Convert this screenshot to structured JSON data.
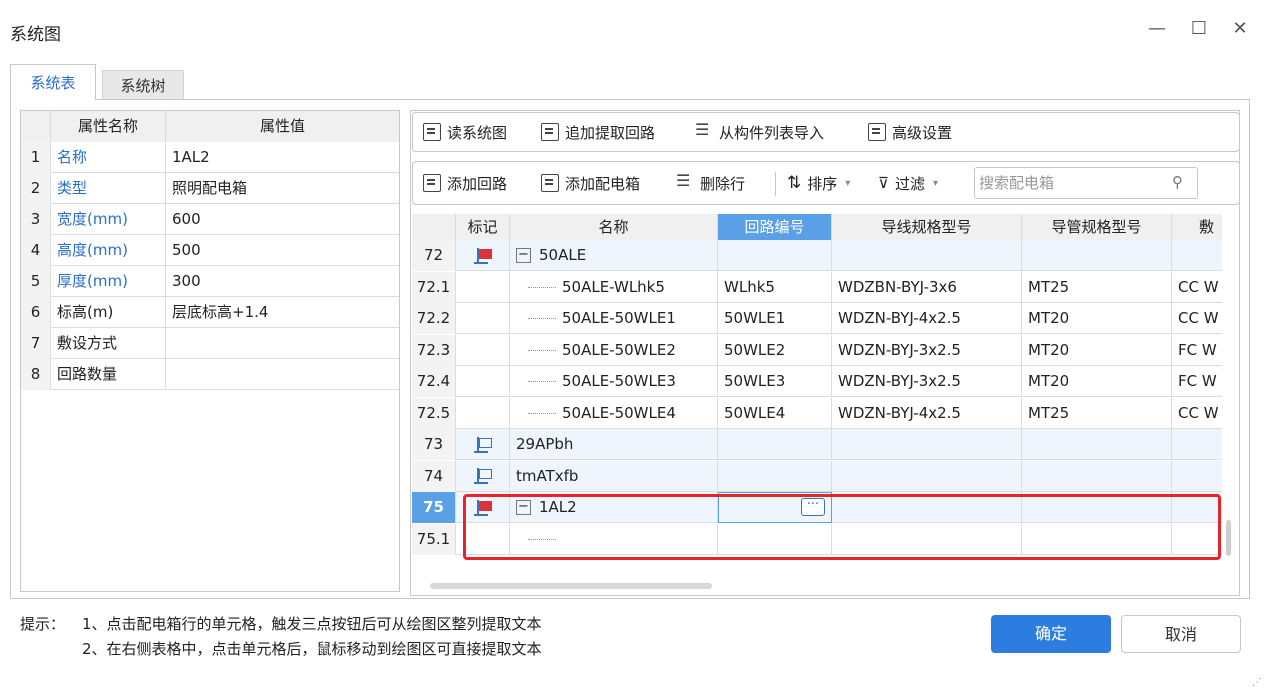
{
  "window": {
    "title": "系统图",
    "minimize": "—",
    "maximize": "☐",
    "close": "✕"
  },
  "tabs": [
    {
      "label": "系统表",
      "active": true
    },
    {
      "label": "系统树",
      "active": false
    }
  ],
  "properties": {
    "headers": [
      "属性名称",
      "属性值"
    ],
    "rows": [
      {
        "num": "1",
        "name": "名称",
        "value": "1AL2"
      },
      {
        "num": "2",
        "name": "类型",
        "value": "照明配电箱"
      },
      {
        "num": "3",
        "name": "宽度(mm)",
        "value": "600"
      },
      {
        "num": "4",
        "name": "高度(mm)",
        "value": "500"
      },
      {
        "num": "5",
        "name": "厚度(mm)",
        "value": "300"
      },
      {
        "num": "6",
        "name": "标高(m)",
        "value": "层底标高+1.4"
      },
      {
        "num": "7",
        "name": "敷设方式",
        "value": ""
      },
      {
        "num": "8",
        "name": "回路数量",
        "value": ""
      }
    ]
  },
  "toolbar1": {
    "read": "读系统图",
    "append": "追加提取回路",
    "import": "从构件列表导入",
    "advanced": "高级设置"
  },
  "toolbar2": {
    "add_circuit": "添加回路",
    "add_box": "添加配电箱",
    "delete_row": "删除行",
    "sort": "排序",
    "filter": "过滤",
    "search_placeholder": "搜索配电箱"
  },
  "grid": {
    "headers": [
      "",
      "标记",
      "名称",
      "回路编号",
      "导线规格型号",
      "导管规格型号",
      "敷"
    ],
    "rows": [
      {
        "num": "72",
        "type": "box",
        "flag": "red",
        "name": "50ALE",
        "code": "",
        "wire": "",
        "pipe": "",
        "lay": ""
      },
      {
        "num": "72.1",
        "type": "child",
        "name": "50ALE-WLhk5",
        "code": "WLhk5",
        "wire": "WDZBN-BYJ-3x6",
        "pipe": "MT25",
        "lay": "CC W"
      },
      {
        "num": "72.2",
        "type": "child",
        "name": "50ALE-50WLE1",
        "code": "50WLE1",
        "wire": "WDZN-BYJ-4x2.5",
        "pipe": "MT20",
        "lay": "CC W"
      },
      {
        "num": "72.3",
        "type": "child",
        "name": "50ALE-50WLE2",
        "code": "50WLE2",
        "wire": "WDZN-BYJ-3x2.5",
        "pipe": "MT20",
        "lay": "FC W"
      },
      {
        "num": "72.4",
        "type": "child",
        "name": "50ALE-50WLE3",
        "code": "50WLE3",
        "wire": "WDZN-BYJ-3x2.5",
        "pipe": "MT20",
        "lay": "FC W"
      },
      {
        "num": "72.5",
        "type": "child",
        "name": "50ALE-50WLE4",
        "code": "50WLE4",
        "wire": "WDZN-BYJ-4x2.5",
        "pipe": "MT25",
        "lay": "CC W"
      },
      {
        "num": "73",
        "type": "box",
        "flag": "blue",
        "name": "29APbh",
        "code": "",
        "wire": "",
        "pipe": "",
        "lay": ""
      },
      {
        "num": "74",
        "type": "box",
        "flag": "blue",
        "name": "tmATxfb",
        "code": "",
        "wire": "",
        "pipe": "",
        "lay": ""
      },
      {
        "num": "75",
        "type": "box",
        "flag": "red",
        "name": "1AL2",
        "code": "",
        "wire": "",
        "pipe": "",
        "lay": "",
        "selected": true
      },
      {
        "num": "75.1",
        "type": "child-empty",
        "name": "",
        "code": "",
        "wire": "",
        "pipe": "",
        "lay": ""
      }
    ]
  },
  "hint": {
    "label": "提示：",
    "line1": "1、点击配电箱行的单元格，触发三点按钮后可从绘图区整列提取文本",
    "line2": "2、在右侧表格中，点击单元格后，鼠标移动到绘图区可直接提取文本"
  },
  "buttons": {
    "ok": "确定",
    "cancel": "取消"
  },
  "colors": {
    "accent": "#2d7de0",
    "highlight": "#e8242b",
    "selected_header": "#5aa0e6"
  }
}
